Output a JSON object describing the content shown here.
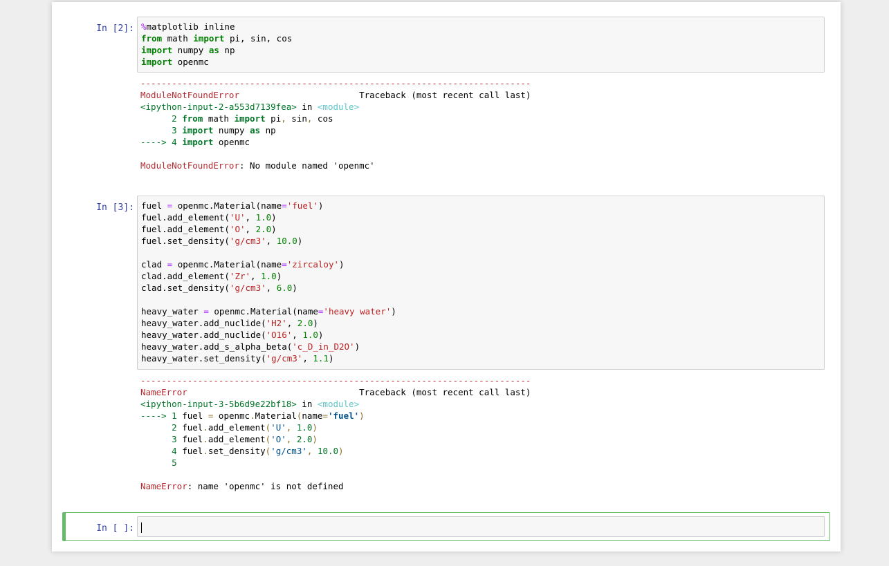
{
  "cells": [
    {
      "prompt": "In [2]:",
      "code": [
        [
          [
            "%",
            "mg"
          ],
          [
            "matplotlib inline",
            ""
          ]
        ],
        [
          [
            "from",
            "kw"
          ],
          [
            " math ",
            ""
          ],
          [
            "import",
            "kw"
          ],
          [
            " pi, sin, cos",
            ""
          ]
        ],
        [
          [
            "import",
            "kw"
          ],
          [
            " numpy ",
            ""
          ],
          [
            "as",
            "kw"
          ],
          [
            " np",
            ""
          ]
        ],
        [
          [
            "import",
            "kw"
          ],
          [
            " openmc",
            ""
          ]
        ]
      ],
      "output": [
        [
          [
            "---------------------------------------------------------------------------",
            "tr-dash"
          ]
        ],
        [
          [
            "ModuleNotFoundError",
            "tr-red"
          ],
          [
            "                       Traceback (most recent call last)",
            ""
          ]
        ],
        [
          [
            "<ipython-input-2-a553d7139fea>",
            "tr-green"
          ],
          [
            " in ",
            ""
          ],
          [
            "<module>",
            "tr-cyan"
          ]
        ],
        [
          [
            "      2 ",
            "tr-ln"
          ],
          [
            "from",
            "tr-kw"
          ],
          [
            " math ",
            ""
          ],
          [
            "import",
            "tr-kw"
          ],
          [
            " pi",
            ""
          ],
          [
            ",",
            "tr-paren"
          ],
          [
            " sin",
            ""
          ],
          [
            ",",
            "tr-paren"
          ],
          [
            " cos",
            ""
          ]
        ],
        [
          [
            "      3 ",
            "tr-ln"
          ],
          [
            "import",
            "tr-kw"
          ],
          [
            " numpy ",
            ""
          ],
          [
            "as",
            "tr-kw"
          ],
          [
            " np",
            ""
          ]
        ],
        [
          [
            "----> 4 ",
            "tr-ln"
          ],
          [
            "import",
            "tr-kw"
          ],
          [
            " openmc",
            ""
          ]
        ],
        [
          [
            "",
            ""
          ]
        ],
        [
          [
            "ModuleNotFoundError",
            "tr-red"
          ],
          [
            ": No module named 'openmc'",
            ""
          ]
        ]
      ]
    },
    {
      "prompt": "In [3]:",
      "code": [
        [
          [
            "fuel ",
            ""
          ],
          [
            "=",
            "op"
          ],
          [
            " openmc.Material(name",
            ""
          ],
          [
            "=",
            "op"
          ],
          [
            "'fuel'",
            "st"
          ],
          [
            ")",
            ""
          ]
        ],
        [
          [
            "fuel.add_element(",
            ""
          ],
          [
            "'U'",
            "st"
          ],
          [
            ", ",
            ""
          ],
          [
            "1.0",
            "nm"
          ],
          [
            ")",
            ""
          ]
        ],
        [
          [
            "fuel.add_element(",
            ""
          ],
          [
            "'O'",
            "st"
          ],
          [
            ", ",
            ""
          ],
          [
            "2.0",
            "nm"
          ],
          [
            ")",
            ""
          ]
        ],
        [
          [
            "fuel.set_density(",
            ""
          ],
          [
            "'g/cm3'",
            "st"
          ],
          [
            ", ",
            ""
          ],
          [
            "10.0",
            "nm"
          ],
          [
            ")",
            ""
          ]
        ],
        [
          [
            "",
            ""
          ]
        ],
        [
          [
            "clad ",
            ""
          ],
          [
            "=",
            "op"
          ],
          [
            " openmc.Material(name",
            ""
          ],
          [
            "=",
            "op"
          ],
          [
            "'zircaloy'",
            "st"
          ],
          [
            ")",
            ""
          ]
        ],
        [
          [
            "clad.add_element(",
            ""
          ],
          [
            "'Zr'",
            "st"
          ],
          [
            ", ",
            ""
          ],
          [
            "1.0",
            "nm"
          ],
          [
            ")",
            ""
          ]
        ],
        [
          [
            "clad.set_density(",
            ""
          ],
          [
            "'g/cm3'",
            "st"
          ],
          [
            ", ",
            ""
          ],
          [
            "6.0",
            "nm"
          ],
          [
            ")",
            ""
          ]
        ],
        [
          [
            "",
            ""
          ]
        ],
        [
          [
            "heavy_water ",
            ""
          ],
          [
            "=",
            "op"
          ],
          [
            " openmc.Material(name",
            ""
          ],
          [
            "=",
            "op"
          ],
          [
            "'heavy water'",
            "st"
          ],
          [
            ")",
            ""
          ]
        ],
        [
          [
            "heavy_water.add_nuclide(",
            ""
          ],
          [
            "'H2'",
            "st"
          ],
          [
            ", ",
            ""
          ],
          [
            "2.0",
            "nm"
          ],
          [
            ")",
            ""
          ]
        ],
        [
          [
            "heavy_water.add_nuclide(",
            ""
          ],
          [
            "'O16'",
            "st"
          ],
          [
            ", ",
            ""
          ],
          [
            "1.0",
            "nm"
          ],
          [
            ")",
            ""
          ]
        ],
        [
          [
            "heavy_water.add_s_alpha_beta(",
            ""
          ],
          [
            "'c_D_in_D2O'",
            "st"
          ],
          [
            ")",
            ""
          ]
        ],
        [
          [
            "heavy_water.set_density(",
            ""
          ],
          [
            "'g/cm3'",
            "st"
          ],
          [
            ", ",
            ""
          ],
          [
            "1.1",
            "nm"
          ],
          [
            ")",
            ""
          ]
        ]
      ],
      "output": [
        [
          [
            "---------------------------------------------------------------------------",
            "tr-dash"
          ]
        ],
        [
          [
            "NameError",
            "tr-red"
          ],
          [
            "                                 Traceback (most recent call last)",
            ""
          ]
        ],
        [
          [
            "<ipython-input-3-5b6d9e22bf18>",
            "tr-green"
          ],
          [
            " in ",
            ""
          ],
          [
            "<module>",
            "tr-cyan"
          ]
        ],
        [
          [
            "----> 1 ",
            "tr-ln"
          ],
          [
            "fuel ",
            ""
          ],
          [
            "=",
            "tr-paren"
          ],
          [
            " openmc",
            ""
          ],
          [
            ".",
            "tr-paren"
          ],
          [
            "Material",
            ""
          ],
          [
            "(",
            "tr-paren"
          ],
          [
            "name",
            ""
          ],
          [
            "=",
            "tr-paren"
          ],
          [
            "'fuel'",
            "tr-st"
          ],
          [
            ")",
            "tr-paren"
          ]
        ],
        [
          [
            "      2 ",
            "tr-ln"
          ],
          [
            "fuel",
            ""
          ],
          [
            ".",
            "tr-paren"
          ],
          [
            "add_element",
            ""
          ],
          [
            "(",
            "tr-paren"
          ],
          [
            "'U'",
            "tr-st2"
          ],
          [
            ", ",
            "tr-paren"
          ],
          [
            "1.0",
            "tr-num"
          ],
          [
            ")",
            "tr-paren"
          ]
        ],
        [
          [
            "      3 ",
            "tr-ln"
          ],
          [
            "fuel",
            ""
          ],
          [
            ".",
            "tr-paren"
          ],
          [
            "add_element",
            ""
          ],
          [
            "(",
            "tr-paren"
          ],
          [
            "'O'",
            "tr-st2"
          ],
          [
            ", ",
            "tr-paren"
          ],
          [
            "2.0",
            "tr-num"
          ],
          [
            ")",
            "tr-paren"
          ]
        ],
        [
          [
            "      4 ",
            "tr-ln"
          ],
          [
            "fuel",
            ""
          ],
          [
            ".",
            "tr-paren"
          ],
          [
            "set_density",
            ""
          ],
          [
            "(",
            "tr-paren"
          ],
          [
            "'g/cm3'",
            "tr-st2"
          ],
          [
            ", ",
            "tr-paren"
          ],
          [
            "10.0",
            "tr-num"
          ],
          [
            ")",
            "tr-paren"
          ]
        ],
        [
          [
            "      5",
            "tr-ln"
          ]
        ],
        [
          [
            "",
            ""
          ]
        ],
        [
          [
            "NameError",
            "tr-red"
          ],
          [
            ": name 'openmc' is not defined",
            ""
          ]
        ]
      ]
    },
    {
      "prompt": "In [ ]:",
      "code": []
    }
  ]
}
